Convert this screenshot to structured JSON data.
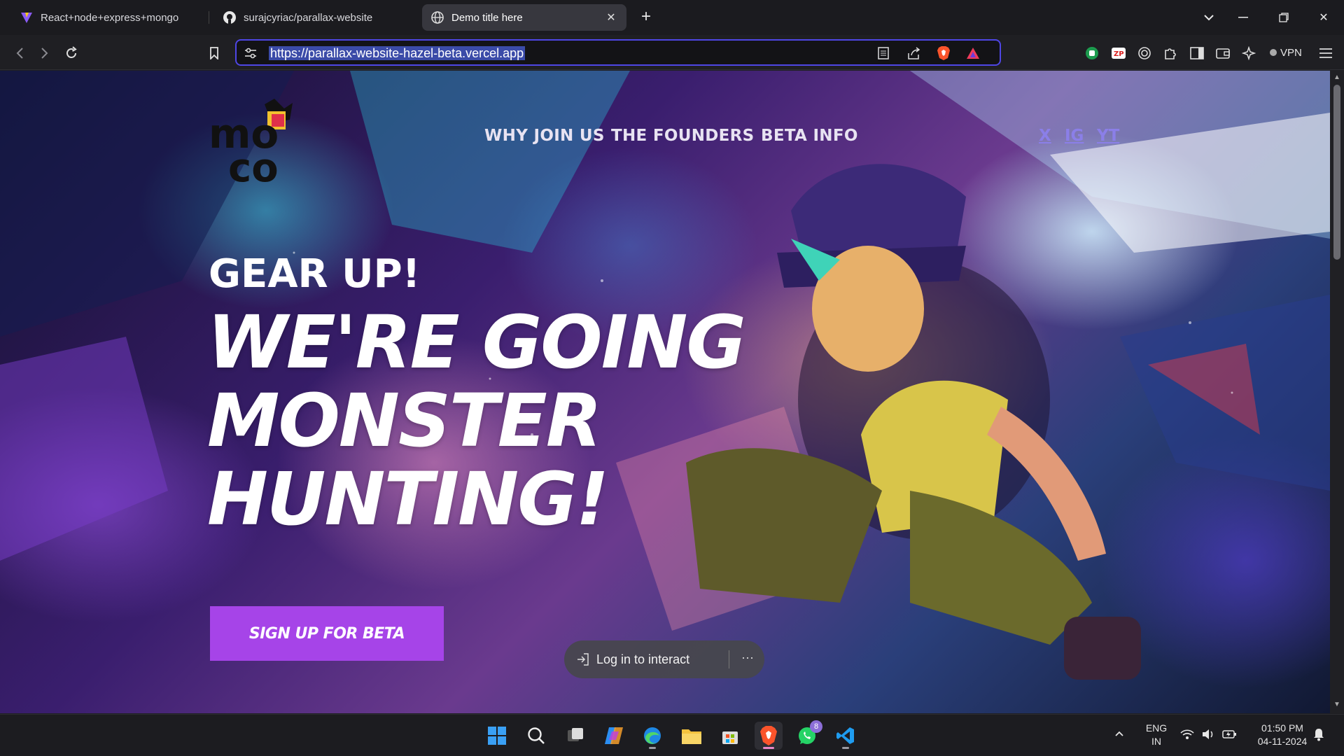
{
  "browser": {
    "tabs": [
      {
        "title": "React+node+express+mongo",
        "active": false
      },
      {
        "title": "surajcyriac/parallax-website",
        "active": false
      },
      {
        "title": "Demo title here",
        "active": true
      }
    ],
    "url": "https://parallax-website-hazel-beta.vercel.app",
    "vpn_label": "VPN"
  },
  "site": {
    "nav": [
      "WHY JOIN US",
      "THE FOUNDERS",
      "BETA INFO"
    ],
    "social": [
      "X",
      "IG",
      "YT"
    ],
    "kicker": "GEAR UP!",
    "headline": [
      "WE'RE GOING",
      "MONSTER",
      "HUNTING!"
    ],
    "cta_label": "SIGN UP FOR BETA",
    "logo_text": [
      "mo",
      "co"
    ]
  },
  "overlay": {
    "login_label": "Log in to interact",
    "more_label": "···"
  },
  "taskbar": {
    "apps": [
      "start",
      "search",
      "task-view",
      "copilot",
      "edge",
      "file-explorer",
      "microsoft-store",
      "brave",
      "whatsapp",
      "vscode"
    ],
    "whatsapp_badge": "8",
    "lang_line1": "ENG",
    "lang_line2": "IN",
    "time": "01:50 PM",
    "date": "04-11-2024"
  },
  "colors": {
    "accent": "#a644e8",
    "nav_text": "#e8e3f2",
    "social_link": "#8b7fe8",
    "url_focus": "#4f46e5"
  }
}
